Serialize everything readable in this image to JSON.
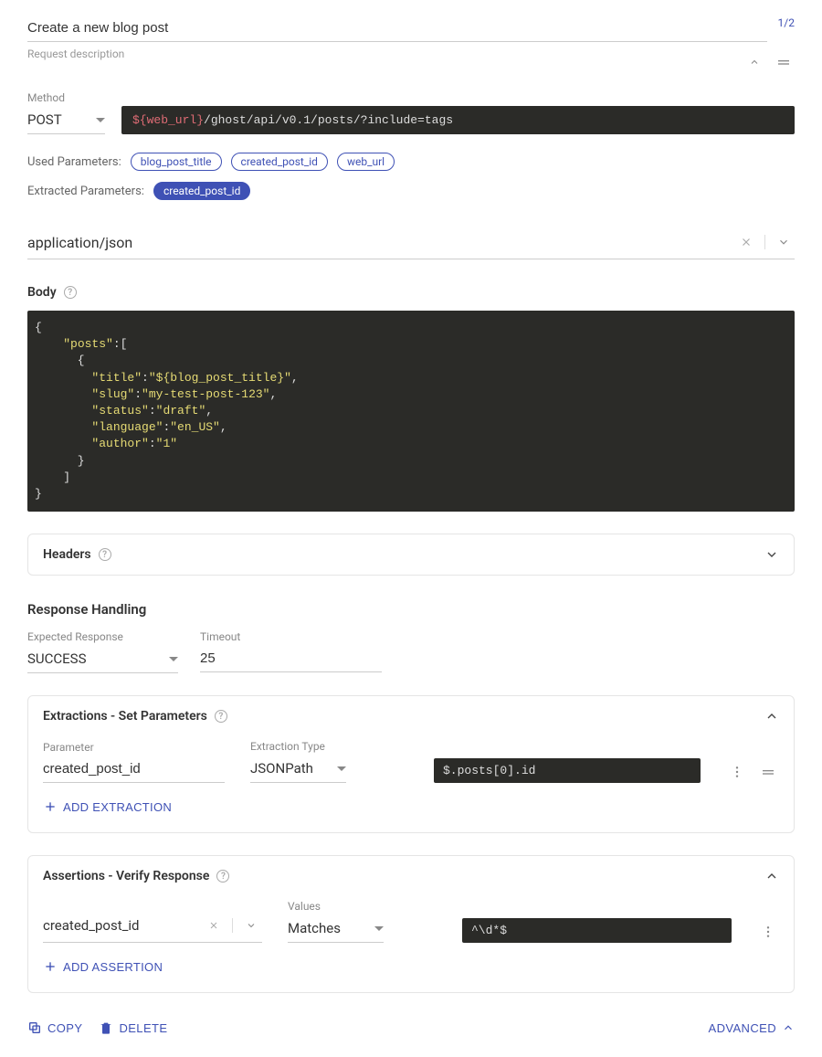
{
  "header": {
    "title": "Create a new blog post",
    "description": "Request description",
    "pager": "1/2"
  },
  "method": {
    "label": "Method",
    "value": "POST"
  },
  "url": {
    "variable": "${web_url}",
    "path": "/ghost/api/v0.1/posts/?include=tags"
  },
  "used_params": {
    "label": "Used Parameters:",
    "items": [
      "blog_post_title",
      "created_post_id",
      "web_url"
    ]
  },
  "extracted_params": {
    "label": "Extracted Parameters:",
    "items": [
      "created_post_id"
    ]
  },
  "content_type": "application/json",
  "body": {
    "label": "Body",
    "code": "{\n    \"posts\":[\n      {\n        \"title\":\"${blog_post_title}\",\n        \"slug\":\"my-test-post-123\",\n        \"status\":\"draft\",\n        \"language\":\"en_US\",\n        \"author\":\"1\"\n      }\n    ]\n}"
  },
  "headers_panel": {
    "title": "Headers"
  },
  "response": {
    "heading": "Response Handling",
    "expected_label": "Expected Response",
    "expected_value": "SUCCESS",
    "timeout_label": "Timeout",
    "timeout_value": "25"
  },
  "extractions": {
    "title": "Extractions - Set Parameters",
    "param_label": "Parameter",
    "param_value": "created_post_id",
    "type_label": "Extraction Type",
    "type_value": "JSONPath",
    "path": "$.posts[0].id",
    "add_label": "ADD EXTRACTION"
  },
  "assertions": {
    "title": "Assertions - Verify Response",
    "param_value": "created_post_id",
    "values_label": "Values",
    "condition": "Matches",
    "pattern": "^\\d*$",
    "add_label": "ADD ASSERTION"
  },
  "footer": {
    "copy": "COPY",
    "delete": "DELETE",
    "advanced": "ADVANCED"
  }
}
